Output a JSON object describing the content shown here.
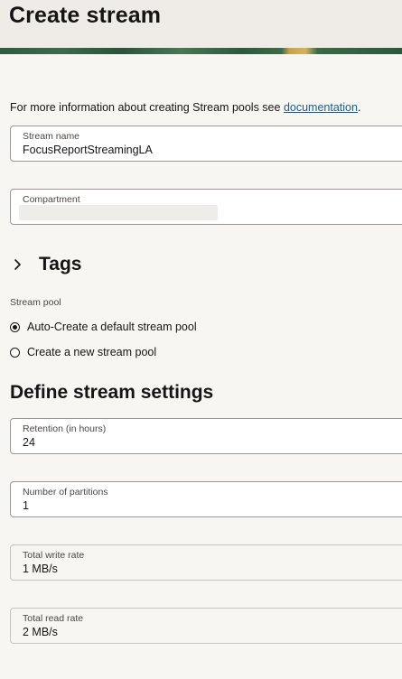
{
  "page": {
    "title": "Create stream"
  },
  "info": {
    "text": "For more information about creating Stream pools see ",
    "link_text": "documentation",
    "suffix": "."
  },
  "fields": {
    "stream_name": {
      "label": "Stream name",
      "value": "FocusReportStreamingLA"
    },
    "compartment": {
      "label": "Compartment",
      "value": ""
    }
  },
  "tags": {
    "title": "Tags",
    "icon": "chevron-right-icon"
  },
  "stream_pool": {
    "label": "Stream pool",
    "options": [
      {
        "label": "Auto-Create a default stream pool",
        "checked": true
      },
      {
        "label": "Create a new stream pool",
        "checked": false
      }
    ]
  },
  "settings": {
    "title": "Define stream settings",
    "retention": {
      "label": "Retention (in hours)",
      "value": "24"
    },
    "partitions": {
      "label": "Number of partitions",
      "value": "1"
    },
    "write_rate": {
      "label": "Total write rate",
      "value": "1 MB/s"
    },
    "read_rate": {
      "label": "Total read rate",
      "value": "2 MB/s"
    }
  }
}
